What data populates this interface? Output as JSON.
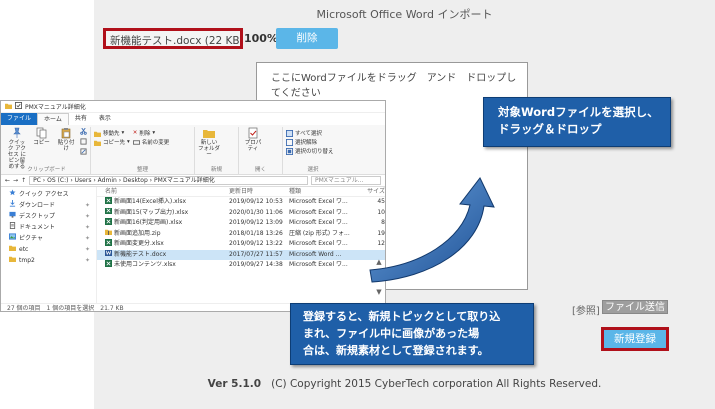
{
  "page": {
    "title": "Microsoft Office Word インポート"
  },
  "upload": {
    "file_label": "新機能テスト.docx (22 KB)",
    "percent": "100%",
    "delete_label": "削除"
  },
  "drop": {
    "text": "ここにWordファイルをドラッグ　アンド　ドロップしてください"
  },
  "explorer": {
    "title": "PMXマニュアル詳細化",
    "tabs": [
      "ファイル",
      "ホーム",
      "共有",
      "表示"
    ],
    "ribbon": {
      "pin_label": "クイック アクセス にピン留めする",
      "copy_label": "コピー",
      "paste_label": "貼り付け",
      "clipboard_group": "クリップボード",
      "move_label": "移動先",
      "copy_to_label": "コピー先",
      "delete_label": "削除",
      "rename_label": "名前の変更",
      "organize_group": "整理",
      "new_folder_label": "新しい フォルダー",
      "new_group": "新規",
      "properties_label": "プロパティ",
      "open_group": "開く",
      "select_all_label": "すべて選択",
      "select_none_label": "選択解除",
      "invert_label": "選択の切り替え",
      "select_group": "選択"
    },
    "address": "PC  ›  OS (C:)  ›  Users  ›  Admin  ›  Desktop  ›  PMXマニュアル詳細化",
    "search_placeholder": "PMXマニュアル...",
    "columns": {
      "name": "名前",
      "date": "更新日時",
      "type": "種類",
      "size": "サイズ"
    },
    "nav": [
      {
        "label": "クイック アクセス",
        "icon": "star-icon"
      },
      {
        "label": "ダウンロード",
        "icon": "download-icon"
      },
      {
        "label": "デスクトップ",
        "icon": "desktop-icon"
      },
      {
        "label": "ドキュメント",
        "icon": "document-icon"
      },
      {
        "label": "ピクチャ",
        "icon": "picture-icon"
      },
      {
        "label": "etc",
        "icon": "folder-icon"
      },
      {
        "label": "tmp2",
        "icon": "folder-icon"
      }
    ],
    "files": [
      {
        "name": "新画面14(Excel挿入).xlsx",
        "date": "2019/09/12 10:53",
        "type": "Microsoft Excel ワ...",
        "size": "45",
        "icon": "excel-icon"
      },
      {
        "name": "新画面15(マップ出力).xlsx",
        "date": "2020/01/30 11:06",
        "type": "Microsoft Excel ワ...",
        "size": "10",
        "icon": "excel-icon"
      },
      {
        "name": "新画面16(判定用画).xlsx",
        "date": "2019/09/12 13:09",
        "type": "Microsoft Excel ワ...",
        "size": "8",
        "icon": "excel-icon"
      },
      {
        "name": "新画面追加用.zip",
        "date": "2018/01/18 13:26",
        "type": "圧縮 (zip 形式) フォ...",
        "size": "19",
        "icon": "zip-icon"
      },
      {
        "name": "新画面変更分.xlsx",
        "date": "2019/09/12 13:22",
        "type": "Microsoft Excel ワ...",
        "size": "12",
        "icon": "excel-icon"
      },
      {
        "name": "新機能テスト.docx",
        "date": "2017/07/27 11:57",
        "type": "Microsoft Word ...",
        "size": "",
        "icon": "word-icon",
        "selected": true
      },
      {
        "name": "未使用コンテンツ.xlsx",
        "date": "2019/09/27 14:38",
        "type": "Microsoft Excel ワ...",
        "size": "",
        "icon": "excel-icon"
      }
    ],
    "status_count": "27 個の項目",
    "status_selected": "1 個の項目を選択　21.7 KB"
  },
  "callouts": {
    "drag": [
      "対象Wordファイルを選択し、",
      "ドラッグ＆ドロップ"
    ],
    "register": [
      "登録すると、新規トピックとして取り込",
      "まれ、ファイル中に画像があった場",
      "合は、新規素材として登録されます。"
    ]
  },
  "actions": {
    "ref_label": "[参照]",
    "send_label": "ファイル送信",
    "register_label": "新規登録"
  },
  "footer": {
    "version": "Ver 5.1.0",
    "copyright": "(C) Copyright 2015 CyberTech corporation All Rights Reserved."
  },
  "colors": {
    "accent_blue": "#5bb6e8",
    "callout_blue": "#1f5fa8",
    "highlight_red": "#b0101a",
    "file_tab_blue": "#1a6fc4"
  }
}
